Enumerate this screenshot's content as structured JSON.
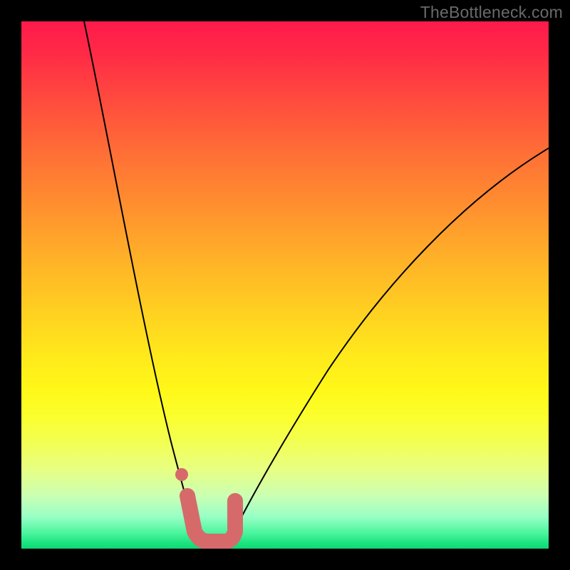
{
  "watermark": "TheBottleneck.com",
  "chart_data": {
    "type": "line",
    "title": "",
    "xlabel": "",
    "ylabel": "",
    "xlim": [
      0,
      100
    ],
    "ylim": [
      0,
      100
    ],
    "grid": false,
    "series": [
      {
        "name": "left-curve",
        "x": [
          12,
          14,
          16,
          18,
          20,
          22,
          24,
          26,
          28,
          30,
          31.5,
          33,
          33.8
        ],
        "y": [
          100,
          90,
          79,
          68,
          57,
          46,
          36,
          27,
          18,
          10,
          5,
          2,
          0.5
        ]
      },
      {
        "name": "right-curve",
        "x": [
          39,
          41,
          44,
          48,
          53,
          58,
          64,
          71,
          78,
          86,
          94,
          100
        ],
        "y": [
          0.5,
          2,
          5,
          10,
          17,
          25,
          34,
          44,
          53,
          62,
          70,
          76
        ]
      },
      {
        "name": "highlight-u",
        "x": [
          31.5,
          32.8,
          34,
          36,
          38,
          39.5,
          40.5
        ],
        "y": [
          10,
          3.2,
          1.3,
          1.0,
          1.3,
          3.2,
          9
        ]
      }
    ],
    "markers": [
      {
        "name": "highlight-dot",
        "x": 30.4,
        "y": 14
      }
    ],
    "colors": {
      "curve": "#000000",
      "highlight": "#d66a6a",
      "background_top": "#ff1a4b",
      "background_bottom": "#19e37e"
    }
  }
}
